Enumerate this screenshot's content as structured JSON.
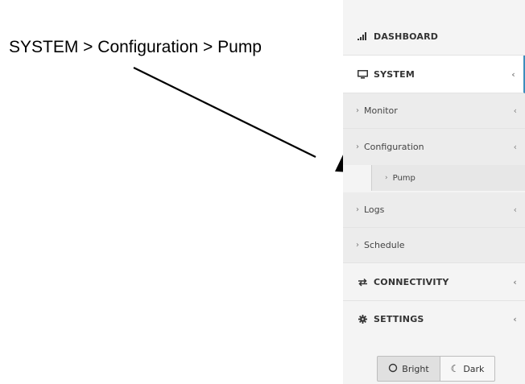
{
  "annotation": {
    "label": "SYSTEM > Configuration > Pump"
  },
  "sidebar": {
    "dashboard": {
      "label": "DASHBOARD",
      "icon": "bar-chart-icon"
    },
    "system": {
      "label": "SYSTEM",
      "icon": "monitor-icon",
      "chevron": "‹"
    },
    "monitor": {
      "label": "Monitor",
      "chevron": "‹"
    },
    "configuration": {
      "label": "Configuration",
      "chevron": "‹"
    },
    "pump": {
      "label": "Pump"
    },
    "logs": {
      "label": "Logs",
      "chevron": "‹"
    },
    "schedule": {
      "label": "Schedule"
    },
    "connectivity": {
      "label": "CONNECTIVITY",
      "icon": "sync-icon",
      "chevron": "‹"
    },
    "settings": {
      "label": "SETTINGS",
      "icon": "gear-icon",
      "chevron": "‹"
    }
  },
  "theme": {
    "bright_label": "Bright",
    "dark_label": "Dark",
    "selected": "Bright"
  },
  "colors": {
    "active_border": "#3c8dbc",
    "sidebar_bg": "#f4f4f4"
  }
}
